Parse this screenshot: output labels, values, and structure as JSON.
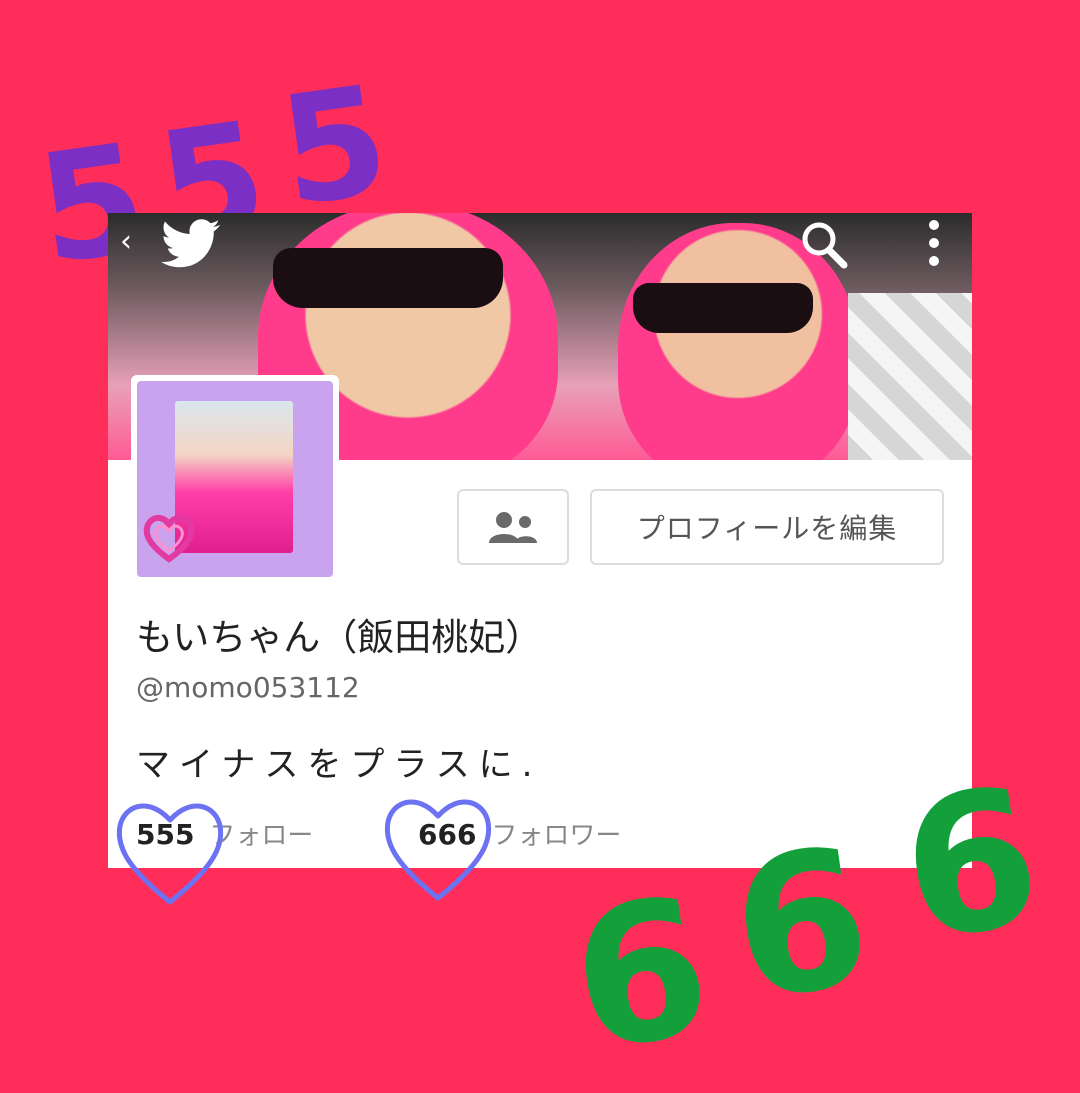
{
  "decor": {
    "top_numbers": [
      "5",
      "5",
      "5"
    ],
    "bottom_numbers": [
      "6",
      "6",
      "6"
    ]
  },
  "profile": {
    "name": "もいちゃん（飯田桃妃）",
    "handle": "@momo053112",
    "bio": "マイナスをプラスに.",
    "edit_button_label": "プロフィールを編集",
    "following_count": "555",
    "following_label": "フォロー",
    "followers_count": "666",
    "followers_label": "フォロワー"
  },
  "colors": {
    "background": "#ff2d5a",
    "top_number": "#7b2fc4",
    "bottom_number": "#13a03a",
    "heart_outline": "#6c72f2"
  },
  "icons": [
    "back-icon",
    "twitter-bird-icon",
    "search-icon",
    "more-options-icon",
    "people-icon",
    "heart-icon"
  ]
}
